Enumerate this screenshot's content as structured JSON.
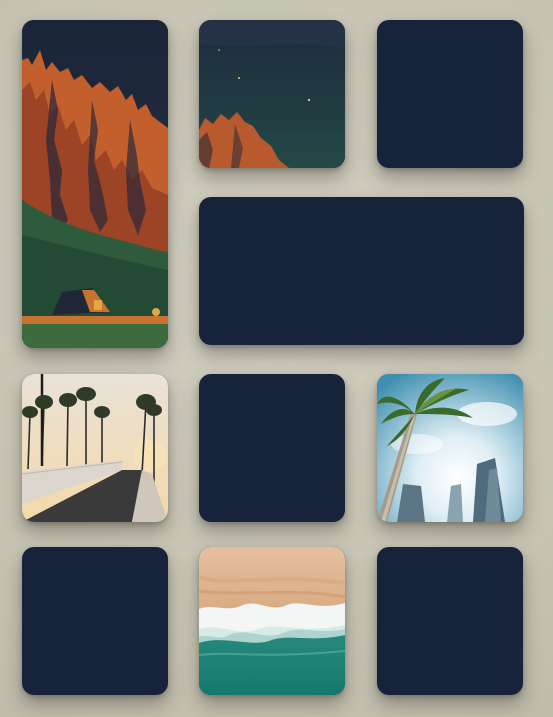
{
  "gallery": {
    "tiles": [
      {
        "name": "desert-mountain-pixel-art",
        "loaded": true
      },
      {
        "name": "night-sky-cliff-pixel-art",
        "loaded": true
      },
      {
        "name": "empty",
        "loaded": false
      },
      {
        "name": "empty-wide",
        "loaded": false
      },
      {
        "name": "palm-tree-boardwalk",
        "loaded": true
      },
      {
        "name": "empty",
        "loaded": false
      },
      {
        "name": "palm-tree-skyscrapers",
        "loaded": true
      },
      {
        "name": "empty",
        "loaded": false
      },
      {
        "name": "aerial-beach-waves",
        "loaded": true
      },
      {
        "name": "empty",
        "loaded": false
      }
    ],
    "colors": {
      "background": "#c9c6b7",
      "placeholder": "#17233b"
    }
  }
}
